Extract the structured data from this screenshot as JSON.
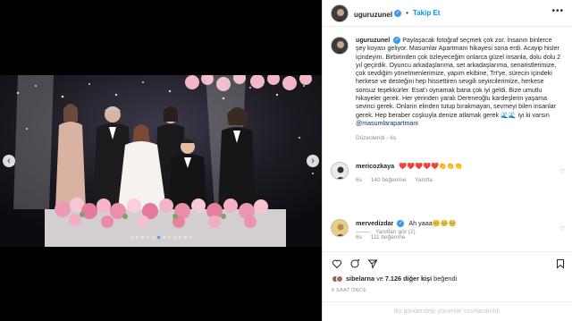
{
  "post": {
    "username": "uguruzunel",
    "follow_label": "Takip Et",
    "more_label": "•••",
    "verified_mark": "✓",
    "carousel": {
      "prev": "‹",
      "next": "›",
      "slide_count": 12,
      "active_slide": 5
    }
  },
  "caption": {
    "username": "uguruzunel",
    "text": "Paylaşacak fotoğraf seçmek çok zor. İnsanın binlerce şey koyası geliyor. Masumlar Apartmanı hikayesi sona erdi. Acayip hisler içindeyim. Birbirinden çok özleyeceğim onlarca güzel insanla, dolu dolu 2 yıl geçirdik. Oyuncu arkadaşlarıma, set arkadaşlarıma, senaristlerimize, çok sevdiğim yönetmenlerimize, yapım ekibine, Trt'ye, sürecin içindeki herkese ve desteğini hep hissettiren sevgili seyircilerimize, herkese sonsuz teşekkürler. Esat'ı oynamak bana çok iyi geldi. Bize umutlu hikayeler gerek. Her yerinden yaralı Dereneoğlu kardeşlerin yaşama sevinci gerek. Onların elinden tutup bırakmayan, sevmeyi bilen insanlar gerek. Hep beraber coşkuyla denize atlamak gerek 🌊🌊 iyi ki varsın ",
    "mention": "@masumlarapartmani",
    "edited": "Düzenlendi · 6s"
  },
  "comments": [
    {
      "username": "mericozkaya",
      "text": "❤️❤️❤️❤️❤️👏👏👏",
      "time": "6s",
      "likes": "140 beğenme",
      "reply": "Yanıtla"
    },
    {
      "username": "mervedizdar",
      "text": "Ah yaaa🥺🥺🥺",
      "time": "6s",
      "likes": "111 beğenme",
      "reply": "Yanıtla"
    }
  ],
  "replies_toggle": "Yanıtları gör (2)",
  "like_summary": {
    "user": "sibelarna",
    "connector": " ve ",
    "others": "7.126 diğer kişi",
    "suffix": " beğendi"
  },
  "timestamp": "6 SAAT ÖNCE",
  "footer_note": "Bu gönderideki yorumlar sınırlandırıldı.",
  "colors": {
    "accent": "#0095f6",
    "heart": "#ed4956",
    "muted": "#8e8e8e"
  }
}
